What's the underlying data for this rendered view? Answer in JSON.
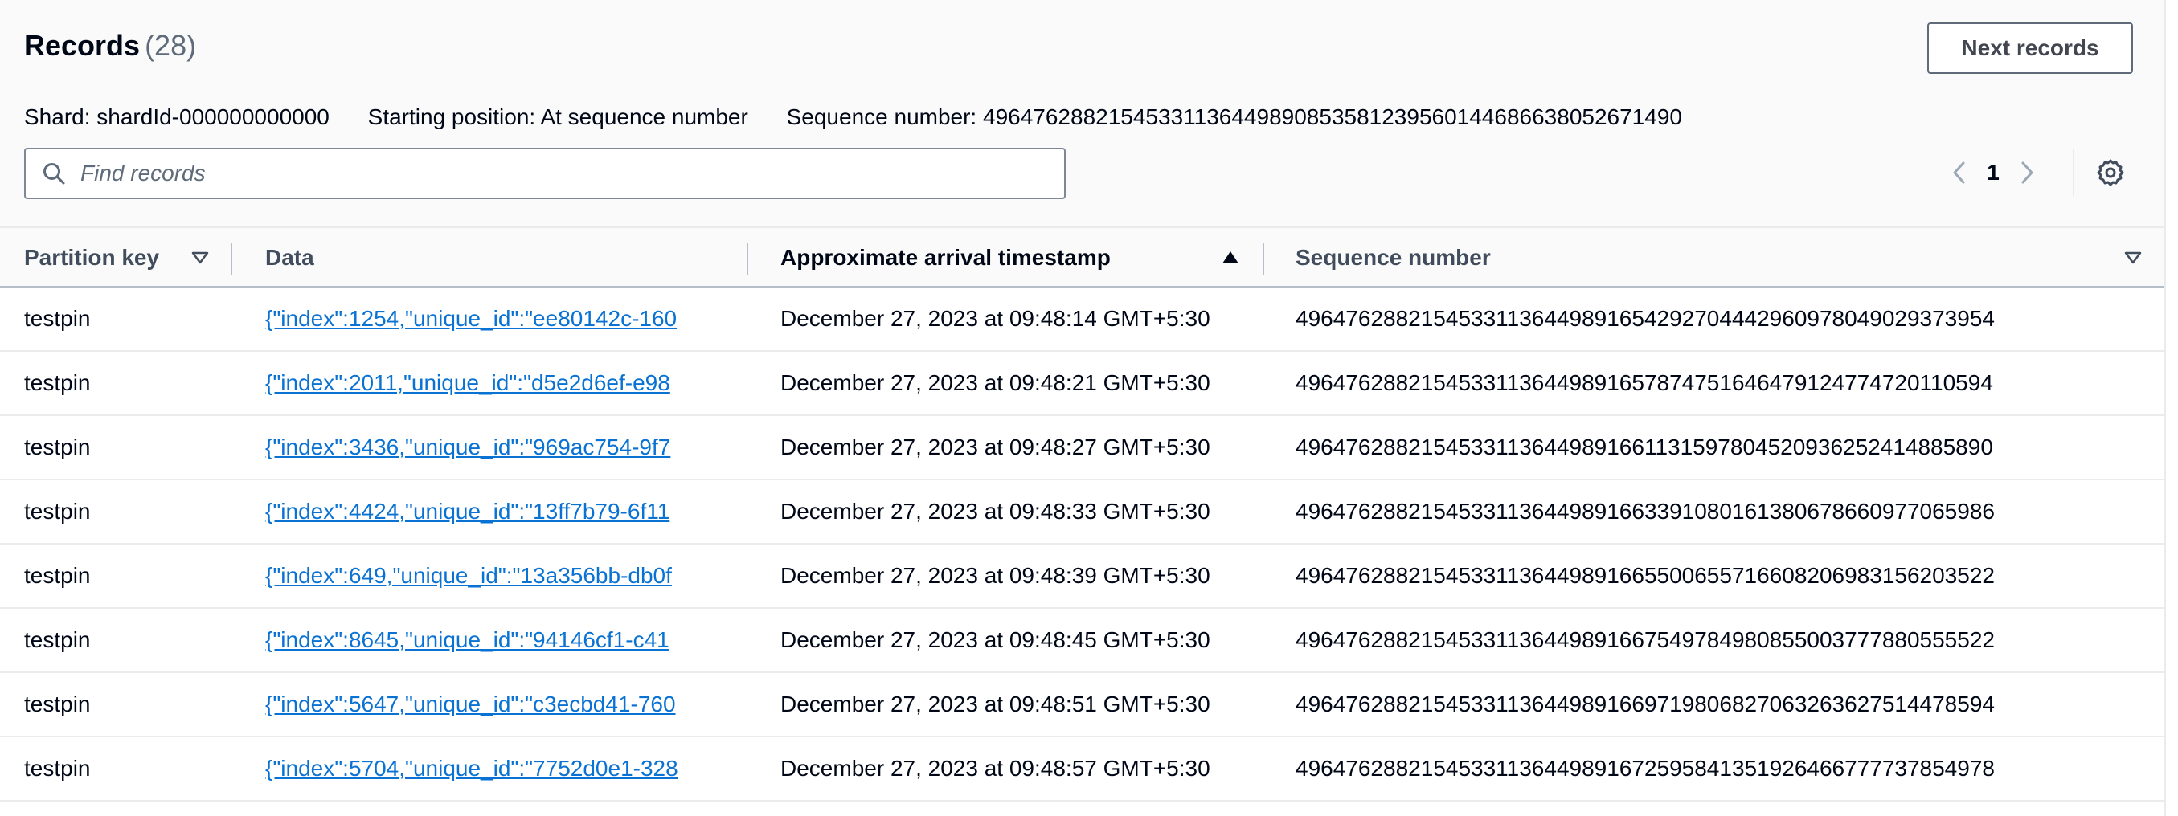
{
  "records": {
    "title": "Records",
    "count": "(28)",
    "next_button": "Next records"
  },
  "meta": {
    "shard": "Shard: shardId-000000000000",
    "starting_position": "Starting position: At sequence number",
    "sequence_number": "Sequence number: 49647628821545331136449890853581239560144686638052671490"
  },
  "search": {
    "placeholder": "Find records",
    "value": ""
  },
  "pagination": {
    "current_page": "1"
  },
  "colors": {
    "link": "#0972d3",
    "text": "#000716",
    "header_text": "#414d5c",
    "border": "#e9ebed",
    "background_header": "#fafafa"
  },
  "icons": {
    "search": "search-icon",
    "prev": "chevron-left-icon",
    "next": "chevron-right-icon",
    "settings": "gear-icon",
    "sort_desc": "caret-down-icon",
    "sort_asc": "caret-up-filled-icon"
  },
  "table": {
    "columns": [
      "Partition key",
      "Data",
      "Approximate arrival timestamp",
      "Sequence number"
    ],
    "sorted_column": "Approximate arrival timestamp",
    "sort_direction": "ascending",
    "rows": [
      {
        "partition_key": "testpin",
        "data": "{\"index\":1254,\"unique_id\":\"ee80142c-160",
        "timestamp": "December 27, 2023 at 09:48:14 GMT+5:30",
        "sequence_number": "49647628821545331136449891654292704442960978049029373954"
      },
      {
        "partition_key": "testpin",
        "data": "{\"index\":2011,\"unique_id\":\"d5e2d6ef-e98",
        "timestamp": "December 27, 2023 at 09:48:21 GMT+5:30",
        "sequence_number": "49647628821545331136449891657874751646479124774720110594"
      },
      {
        "partition_key": "testpin",
        "data": "{\"index\":3436,\"unique_id\":\"969ac754-9f7",
        "timestamp": "December 27, 2023 at 09:48:27 GMT+5:30",
        "sequence_number": "49647628821545331136449891661131597804520936252414885890"
      },
      {
        "partition_key": "testpin",
        "data": "{\"index\":4424,\"unique_id\":\"13ff7b79-6f11",
        "timestamp": "December 27, 2023 at 09:48:33 GMT+5:30",
        "sequence_number": "49647628821545331136449891663391080161380678660977065986"
      },
      {
        "partition_key": "testpin",
        "data": "{\"index\":649,\"unique_id\":\"13a356bb-db0f",
        "timestamp": "December 27, 2023 at 09:48:39 GMT+5:30",
        "sequence_number": "49647628821545331136449891665500655716608206983156203522"
      },
      {
        "partition_key": "testpin",
        "data": "{\"index\":8645,\"unique_id\":\"94146cf1-c41",
        "timestamp": "December 27, 2023 at 09:48:45 GMT+5:30",
        "sequence_number": "49647628821545331136449891667549784980855003777880555522"
      },
      {
        "partition_key": "testpin",
        "data": "{\"index\":5647,\"unique_id\":\"c3ecbd41-760",
        "timestamp": "December 27, 2023 at 09:48:51 GMT+5:30",
        "sequence_number": "49647628821545331136449891669719806827063263627514478594"
      },
      {
        "partition_key": "testpin",
        "data": "{\"index\":5704,\"unique_id\":\"7752d0e1-328",
        "timestamp": "December 27, 2023 at 09:48:57 GMT+5:30",
        "sequence_number": "49647628821545331136449891672595841351926466777737854978"
      }
    ]
  }
}
